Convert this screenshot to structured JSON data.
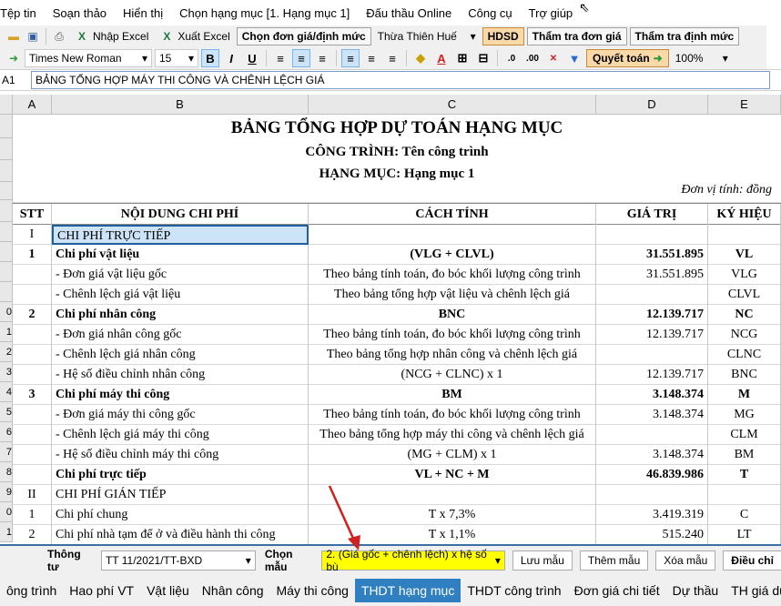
{
  "menu": [
    "Tệp tin",
    "Soạn thảo",
    "Hiển thị",
    "Chọn hạng mục [1. Hạng mục 1]",
    "Đấu thầu Online",
    "Công cụ",
    "Trợ giúp"
  ],
  "toolbar1": {
    "import_excel": "Nhập Excel",
    "export_excel": "Xuất Excel",
    "choose_price": "Chọn đơn giá/định mức",
    "province": "Thừa Thiên Huế",
    "hdsd": "HDSD",
    "check_price": "Thẩm tra đơn giá",
    "check_norm": "Thẩm tra định mức"
  },
  "toolbar2": {
    "font": "Times New Roman",
    "size": "15",
    "settle": "Quyết toán",
    "zoom": "100%"
  },
  "formula": {
    "cell": "A1",
    "value": "BẢNG TỔNG HỢP MÁY THI CÔNG VÀ CHÊNH LỆCH GIÁ"
  },
  "columns": [
    "A",
    "B",
    "C",
    "D",
    "E"
  ],
  "sheet": {
    "title": "BẢNG TỔNG HỢP DỰ TOÁN HẠNG MỤC",
    "project": "CÔNG TRÌNH: Tên công trình",
    "item": "HẠNG MỤC: Hạng mục 1",
    "unit": "Đơn vị tính: đồng",
    "headers": [
      "STT",
      "NỘI DUNG CHI PHÍ",
      "CÁCH TÍNH",
      "GIÁ TRỊ",
      "KÝ HIỆU"
    ]
  },
  "row_numbers": [
    "",
    "",
    "",
    "",
    "",
    "",
    "",
    "",
    "",
    "0",
    "1",
    "2",
    "3",
    "4",
    "5",
    "6",
    "7",
    "8",
    "9",
    "0",
    "1"
  ],
  "rows": [
    {
      "stt": "I",
      "content": "CHI PHÍ TRỰC TIẾP",
      "calc": "",
      "value": "",
      "sym": "",
      "bold": false
    },
    {
      "stt": "1",
      "content": "Chi phí vật liệu",
      "calc": "(VLG + CLVL)",
      "value": "31.551.895",
      "sym": "VL",
      "bold": true
    },
    {
      "stt": "",
      "content": "- Đơn giá vật liệu gốc",
      "calc": "Theo bảng tính toán, đo bóc khối lượng công trình",
      "value": "31.551.895",
      "sym": "VLG",
      "bold": false
    },
    {
      "stt": "",
      "content": "- Chênh lệch giá vật liệu",
      "calc": "Theo bảng tổng hợp vật liệu và chênh lệch giá",
      "value": "",
      "sym": "CLVL",
      "bold": false
    },
    {
      "stt": "2",
      "content": "Chi phí nhân công",
      "calc": "BNC",
      "value": "12.139.717",
      "sym": "NC",
      "bold": true
    },
    {
      "stt": "",
      "content": "- Đơn giá nhân công gốc",
      "calc": "Theo bảng tính toán, đo bóc khối lượng công trình",
      "value": "12.139.717",
      "sym": "NCG",
      "bold": false
    },
    {
      "stt": "",
      "content": "- Chênh lệch giá nhân công",
      "calc": "Theo bảng tổng hợp nhân công và chênh lệch giá",
      "value": "",
      "sym": "CLNC",
      "bold": false
    },
    {
      "stt": "",
      "content": "- Hệ số điều chỉnh nhân công",
      "calc": "(NCG + CLNC) x 1",
      "value": "12.139.717",
      "sym": "BNC",
      "bold": false
    },
    {
      "stt": "3",
      "content": "Chi phí máy thi công",
      "calc": "BM",
      "value": "3.148.374",
      "sym": "M",
      "bold": true
    },
    {
      "stt": "",
      "content": "- Đơn giá máy thi công gốc",
      "calc": "Theo bảng tính toán, đo bóc khối lượng công trình",
      "value": "3.148.374",
      "sym": "MG",
      "bold": false
    },
    {
      "stt": "",
      "content": "- Chênh lệch giá máy thi công",
      "calc": "Theo bảng tổng hợp máy thi công và chênh lệch giá",
      "value": "",
      "sym": "CLM",
      "bold": false
    },
    {
      "stt": "",
      "content": "- Hệ số điều chỉnh máy thi công",
      "calc": "(MG + CLM) x 1",
      "value": "3.148.374",
      "sym": "BM",
      "bold": false
    },
    {
      "stt": "",
      "content": "Chi phí trực tiếp",
      "calc": "VL + NC + M",
      "value": "46.839.986",
      "sym": "T",
      "bold": true
    },
    {
      "stt": "II",
      "content": "CHI PHÍ GIÁN TIẾP",
      "calc": "",
      "value": "",
      "sym": "",
      "bold": false
    },
    {
      "stt": "1",
      "content": "Chi phí chung",
      "calc": "T x 7,3%",
      "value": "3.419.319",
      "sym": "C",
      "bold": false
    },
    {
      "stt": "2",
      "content": "Chi phí nhà tạm để ở và điều hành thi công",
      "calc": "T x 1,1%",
      "value": "515.240",
      "sym": "LT",
      "bold": false
    }
  ],
  "bottom": {
    "circular_label": "Thông tư",
    "circular_value": "TT 11/2021/TT-BXD",
    "template_label": "Chọn mẫu",
    "template_value": "2. (Giá gốc + chênh lệch) x hệ số bù",
    "save": "Lưu mẫu",
    "add": "Thêm mẫu",
    "delete": "Xóa mẫu",
    "adjust": "Điều chỉ"
  },
  "tabs": [
    "ông trình",
    "Hao phí VT",
    "Vật liệu",
    "Nhân công",
    "Máy thi công",
    "THDT hạng mục",
    "THDT công trình",
    "Đơn giá chi tiết",
    "Dự thầu",
    "TH giá dự thầu"
  ],
  "active_tab": 5,
  "colors": {
    "accent": "#2f7fc1",
    "selected_cell": "#cde3f7",
    "highlight": "#ffff00"
  }
}
